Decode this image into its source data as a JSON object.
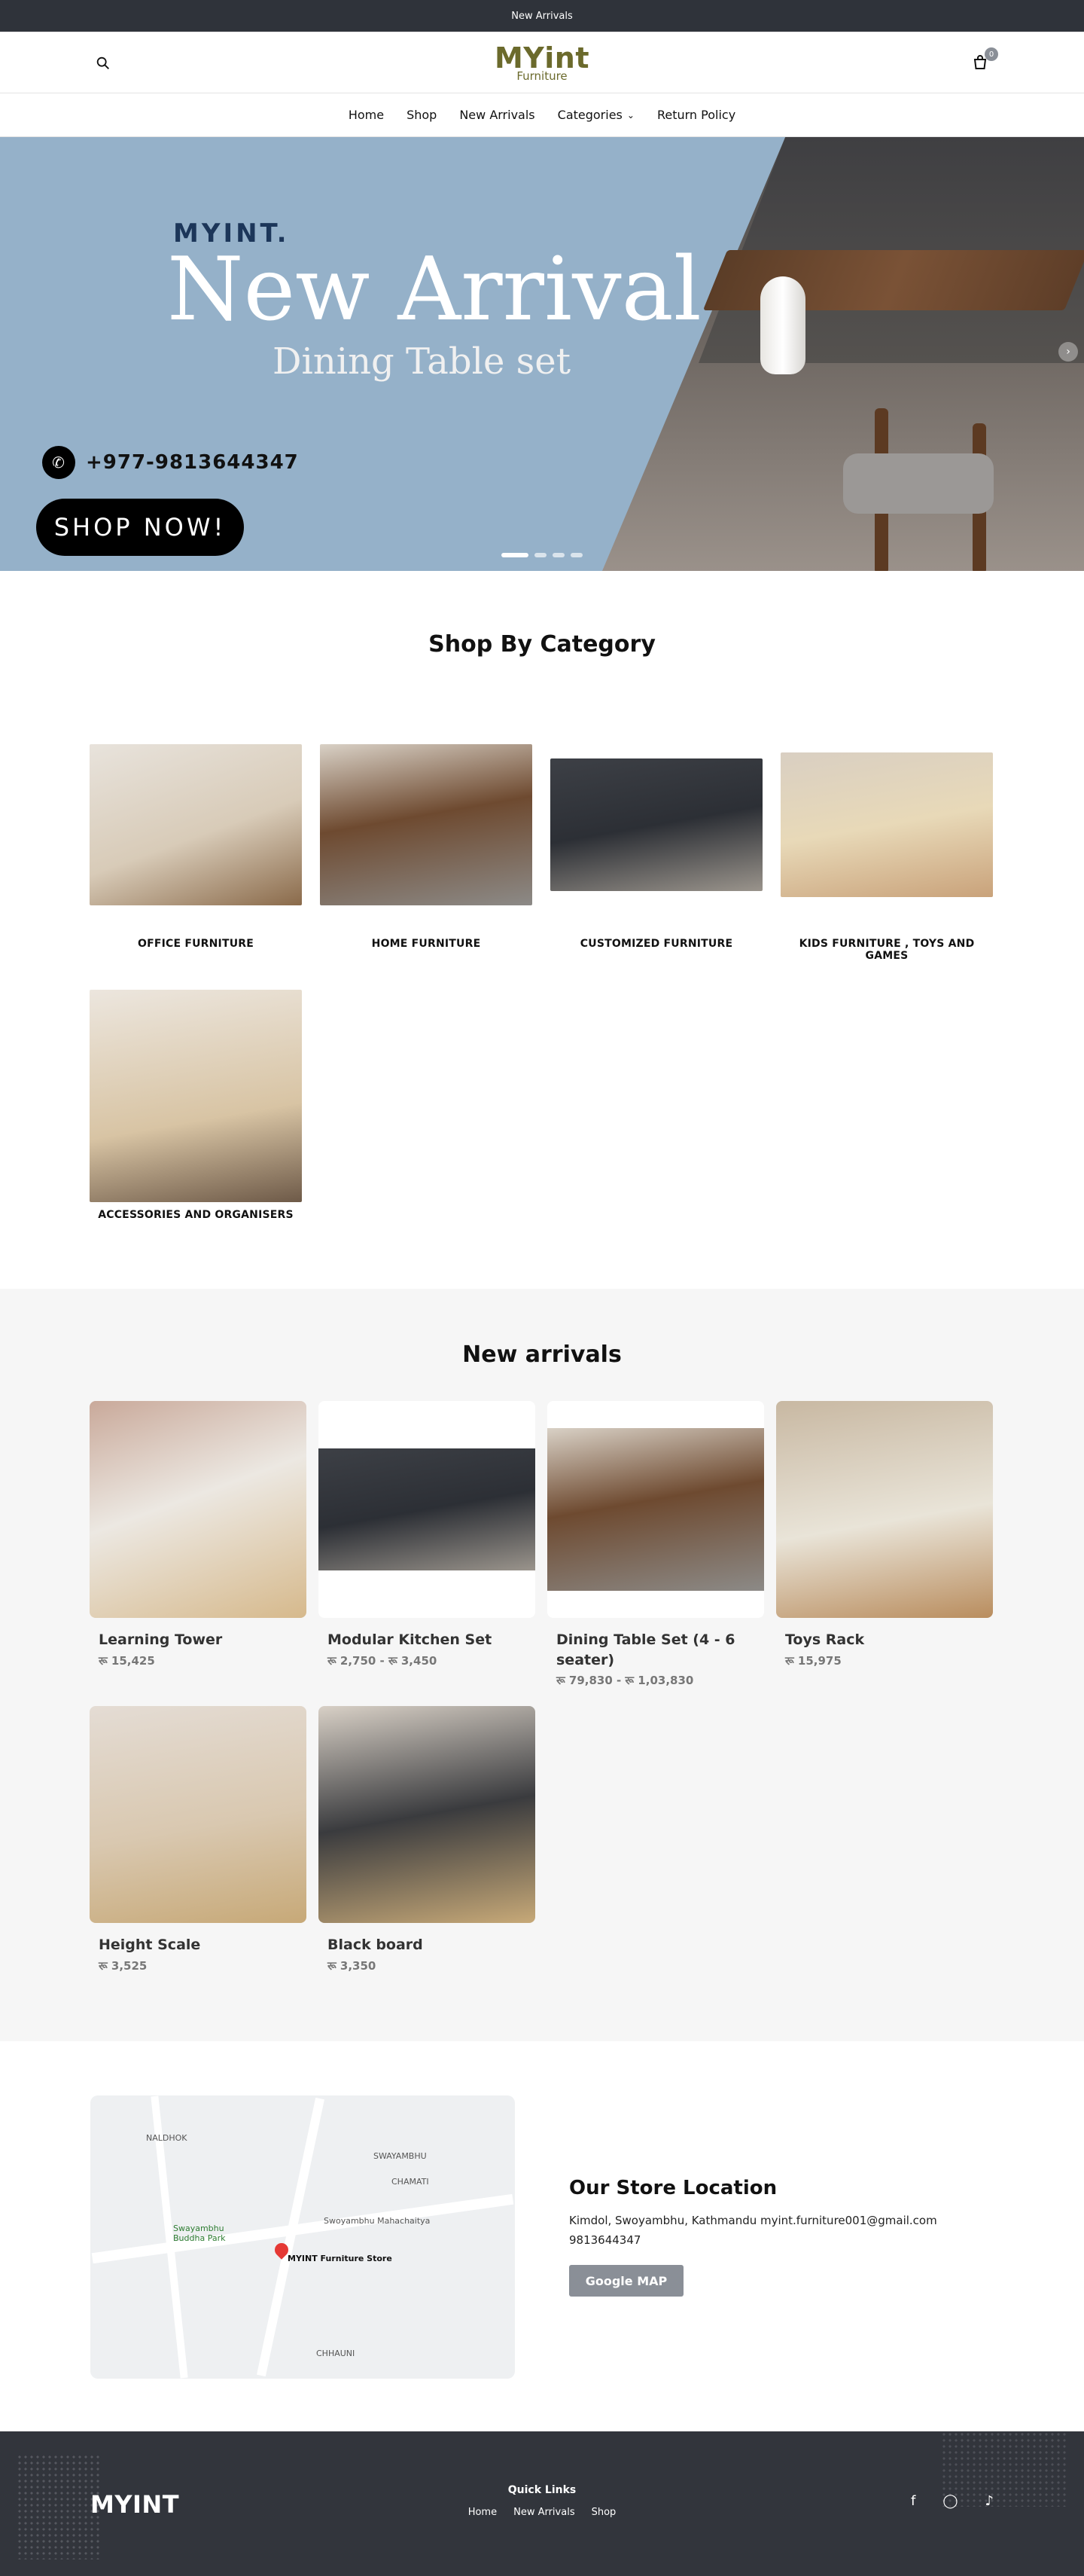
{
  "topbar": {
    "text": "New Arrivals"
  },
  "header": {
    "brand": "MYint",
    "brand_sub": "Furniture",
    "cart_count": "0"
  },
  "nav": {
    "items": [
      {
        "label": "Home"
      },
      {
        "label": "Shop"
      },
      {
        "label": "New Arrivals"
      },
      {
        "label": "Categories"
      },
      {
        "label": "Return Policy"
      }
    ]
  },
  "hero": {
    "brand": "MYINT.",
    "headline": "New Arrival",
    "subline": "Dining  Table set",
    "phone": "+977-9813644347",
    "cta": "SHOP NOW!"
  },
  "categories": {
    "title": "Shop By Category",
    "items": [
      {
        "name": "OFFICE FURNITURE"
      },
      {
        "name": "HOME FURNITURE"
      },
      {
        "name": "CUSTOMIZED FURNITURE"
      },
      {
        "name": "KIDS FURNITURE , TOYS AND GAMES"
      },
      {
        "name": "ACCESSORIES AND ORGANISERS"
      }
    ]
  },
  "arrivals": {
    "title": "New arrivals",
    "items": [
      {
        "title": "Learning Tower",
        "price": "रू 15,425"
      },
      {
        "title": "Modular Kitchen Set",
        "price": "रू 2,750 - रू 3,450"
      },
      {
        "title": "Dining Table Set (4 - 6 seater)",
        "price": "रू 79,830 - रू 1,03,830"
      },
      {
        "title": "Toys Rack",
        "price": "रू 15,975"
      },
      {
        "title": "Height Scale",
        "price": "रू 3,525"
      },
      {
        "title": "Black board",
        "price": "रू 3,350"
      }
    ]
  },
  "store": {
    "title": "Our Store Location",
    "address": "Kimdol, Swoyambhu, Kathmandu myint.furniture001@gmail.com",
    "phone": "9813644347",
    "button": "Google MAP",
    "map_labels": {
      "store": "MYINT Furniture Store",
      "park": "Swayambhu Buddha Park",
      "mahachaitya": "Swoyambhu Mahachaitya",
      "chamati": "CHAMATI",
      "naldhok": "NALDHOK",
      "chhauni": "CHHAUNI",
      "swayambhu": "SWAYAMBHU"
    }
  },
  "footer": {
    "logo": "MYINT",
    "quick_title": "Quick Links",
    "links": [
      {
        "label": "Home"
      },
      {
        "label": "New Arrivals"
      },
      {
        "label": "Shop"
      }
    ]
  }
}
